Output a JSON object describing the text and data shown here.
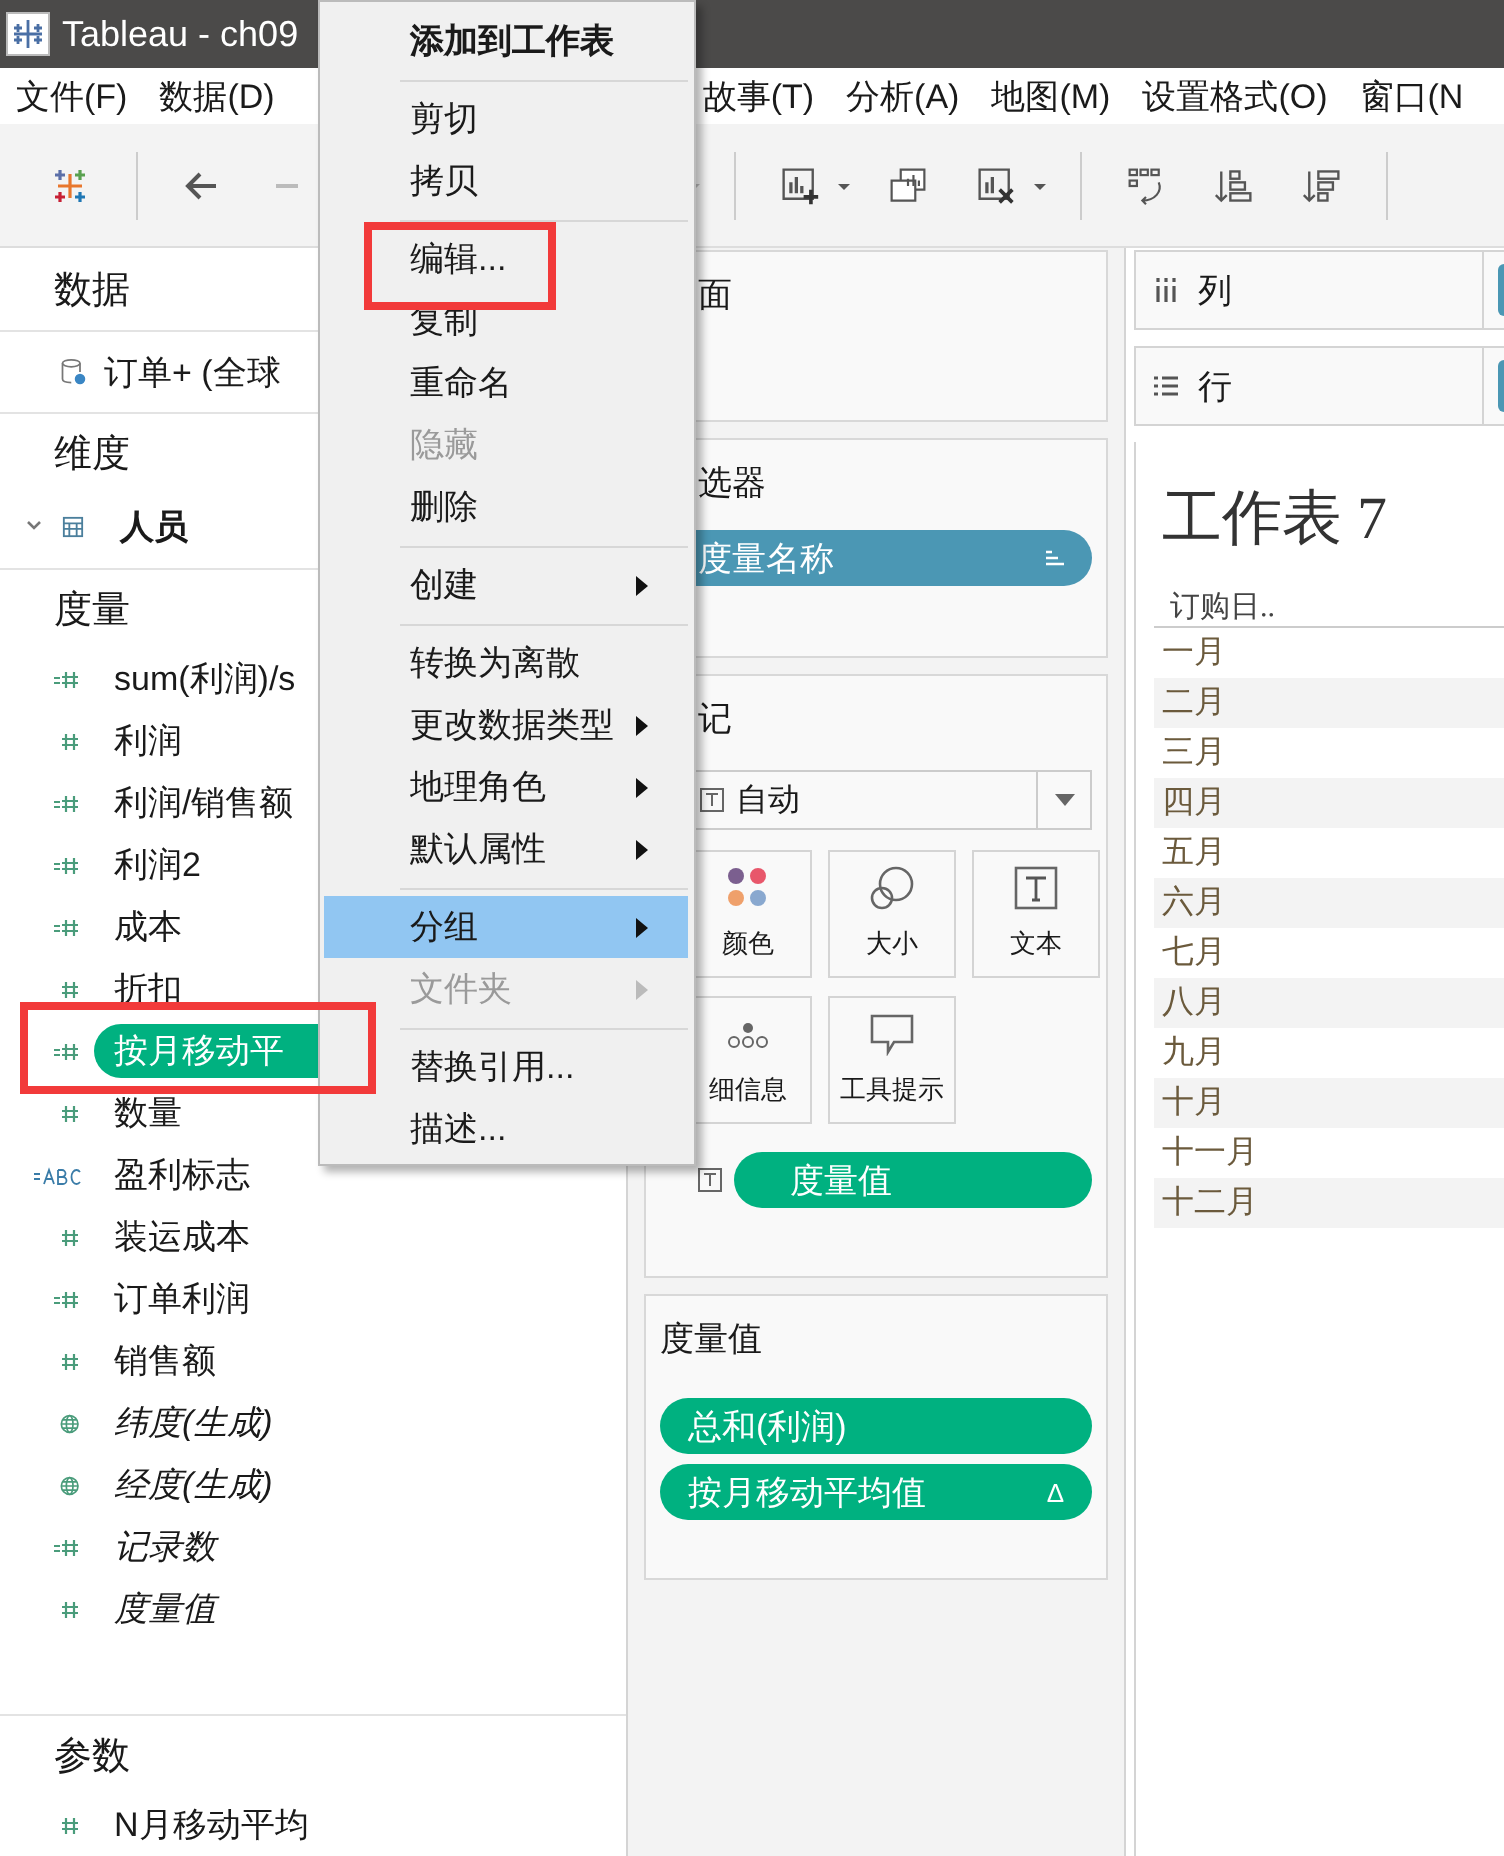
{
  "window": {
    "title": "Tableau - ch09"
  },
  "menubar": [
    "文件(F)",
    "数据(D)",
    "故事(T)",
    "分析(A)",
    "地图(M)",
    "设置格式(O)",
    "窗口(N"
  ],
  "data_pane": {
    "title": "数据",
    "datasource": "订单+ (全球"
  },
  "dimensions": {
    "title": "维度",
    "items": [
      {
        "label": "人员"
      }
    ]
  },
  "measures": {
    "title": "度量",
    "items": [
      {
        "label": "sum(利润)/s",
        "kind": "calc",
        "italic": false,
        "selected": false,
        "annotated": false
      },
      {
        "label": "利润",
        "kind": "number",
        "italic": false,
        "selected": false,
        "annotated": false
      },
      {
        "label": "利润/销售额",
        "kind": "calc",
        "italic": false,
        "selected": false,
        "annotated": false
      },
      {
        "label": "利润2",
        "kind": "calc",
        "italic": false,
        "selected": false,
        "annotated": false
      },
      {
        "label": "成本",
        "kind": "calc",
        "italic": false,
        "selected": false,
        "annotated": false
      },
      {
        "label": "折扣",
        "kind": "number",
        "italic": false,
        "selected": false,
        "annotated": false
      },
      {
        "label": "按月移动平",
        "kind": "calc",
        "italic": false,
        "selected": true,
        "annotated": true
      },
      {
        "label": "数量",
        "kind": "number",
        "italic": false,
        "selected": false,
        "annotated": false
      },
      {
        "label": "盈利标志",
        "kind": "calc-text",
        "italic": false,
        "selected": false,
        "annotated": false
      },
      {
        "label": "装运成本",
        "kind": "number",
        "italic": false,
        "selected": false,
        "annotated": false
      },
      {
        "label": "订单利润",
        "kind": "calc",
        "italic": false,
        "selected": false,
        "annotated": false
      },
      {
        "label": "销售额",
        "kind": "number",
        "italic": false,
        "selected": false,
        "annotated": false
      },
      {
        "label": "纬度(生成)",
        "kind": "geo",
        "italic": true,
        "selected": false,
        "annotated": false
      },
      {
        "label": "经度(生成)",
        "kind": "geo",
        "italic": true,
        "selected": false,
        "annotated": false
      },
      {
        "label": "记录数",
        "kind": "calc",
        "italic": true,
        "selected": false,
        "annotated": false
      },
      {
        "label": "度量值",
        "kind": "number",
        "italic": true,
        "selected": false,
        "annotated": false
      }
    ]
  },
  "parameters": {
    "title": "参数",
    "items": [
      {
        "label": "N月移动平均",
        "kind": "number"
      }
    ]
  },
  "context_menu": {
    "items": [
      {
        "kind": "item",
        "label": "添加到工作表",
        "default": true,
        "submenu": false,
        "disabled": false,
        "selected": false,
        "annotated": false
      },
      {
        "kind": "separator"
      },
      {
        "kind": "item",
        "label": "剪切",
        "default": false,
        "submenu": false,
        "disabled": false,
        "selected": false,
        "annotated": false
      },
      {
        "kind": "item",
        "label": "拷贝",
        "default": false,
        "submenu": false,
        "disabled": false,
        "selected": false,
        "annotated": false
      },
      {
        "kind": "separator"
      },
      {
        "kind": "item",
        "label": "编辑...",
        "default": false,
        "submenu": false,
        "disabled": false,
        "selected": false,
        "annotated": true
      },
      {
        "kind": "item",
        "label": "复制",
        "default": false,
        "submenu": false,
        "disabled": false,
        "selected": false,
        "annotated": false
      },
      {
        "kind": "item",
        "label": "重命名",
        "default": false,
        "submenu": false,
        "disabled": false,
        "selected": false,
        "annotated": false
      },
      {
        "kind": "item",
        "label": "隐藏",
        "default": false,
        "submenu": false,
        "disabled": true,
        "selected": false,
        "annotated": false
      },
      {
        "kind": "item",
        "label": "删除",
        "default": false,
        "submenu": false,
        "disabled": false,
        "selected": false,
        "annotated": false
      },
      {
        "kind": "separator"
      },
      {
        "kind": "item",
        "label": "创建",
        "default": false,
        "submenu": true,
        "disabled": false,
        "selected": false,
        "annotated": false
      },
      {
        "kind": "separator"
      },
      {
        "kind": "item",
        "label": "转换为离散",
        "default": false,
        "submenu": false,
        "disabled": false,
        "selected": false,
        "annotated": false
      },
      {
        "kind": "item",
        "label": "更改数据类型",
        "default": false,
        "submenu": true,
        "disabled": false,
        "selected": false,
        "annotated": false
      },
      {
        "kind": "item",
        "label": "地理角色",
        "default": false,
        "submenu": true,
        "disabled": false,
        "selected": false,
        "annotated": false
      },
      {
        "kind": "item",
        "label": "默认属性",
        "default": false,
        "submenu": true,
        "disabled": false,
        "selected": false,
        "annotated": false
      },
      {
        "kind": "separator"
      },
      {
        "kind": "item",
        "label": "分组",
        "default": false,
        "submenu": true,
        "disabled": false,
        "selected": true,
        "annotated": false
      },
      {
        "kind": "item",
        "label": "文件夹",
        "default": false,
        "submenu": true,
        "disabled": true,
        "selected": false,
        "annotated": false
      },
      {
        "kind": "separator"
      },
      {
        "kind": "item",
        "label": "替换引用...",
        "default": false,
        "submenu": false,
        "disabled": false,
        "selected": false,
        "annotated": false
      },
      {
        "kind": "item",
        "label": "描述...",
        "default": false,
        "submenu": false,
        "disabled": false,
        "selected": false,
        "annotated": false
      }
    ]
  },
  "pages_shelf": {
    "title": "面"
  },
  "filters_shelf": {
    "title": "选器",
    "pills": [
      {
        "label": "度量名称"
      }
    ]
  },
  "marks": {
    "title": "记",
    "mark_type": "自动",
    "buttons": [
      {
        "kind": "color",
        "label": "颜色"
      },
      {
        "kind": "size",
        "label": "大小"
      },
      {
        "kind": "text",
        "label": "文本"
      },
      {
        "kind": "detail",
        "label": "细信息"
      },
      {
        "kind": "tooltip",
        "label": "工具提示"
      }
    ],
    "fields": [
      {
        "label": "度量值"
      }
    ]
  },
  "measure_values": {
    "title": "度量值",
    "pills": [
      {
        "label": "总和(利润)"
      },
      {
        "label": "按月移动平均值",
        "badge": "Δ"
      }
    ]
  },
  "columns_shelf": {
    "label": "列"
  },
  "rows_shelf": {
    "label": "行"
  },
  "sheet": {
    "title": "工作表 7",
    "header": "订购日..",
    "rows": [
      "一月",
      "二月",
      "三月",
      "四月",
      "五月",
      "六月",
      "七月",
      "八月",
      "九月",
      "十月",
      "十一月",
      "十二月"
    ]
  }
}
